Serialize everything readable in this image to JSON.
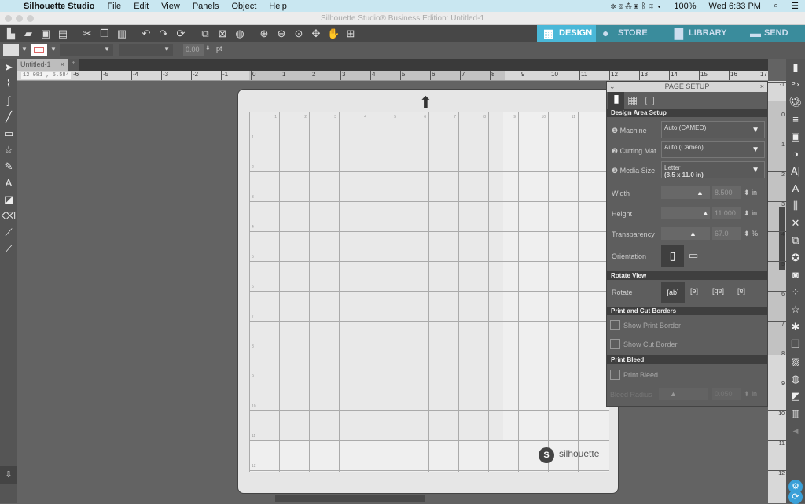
{
  "menubar": {
    "app": "Silhouette Studio",
    "items": [
      "File",
      "Edit",
      "View",
      "Panels",
      "Object",
      "Help"
    ],
    "battery": "100%",
    "clock": "Wed 6:33 PM"
  },
  "window": {
    "title": "Silhouette Studio® Business Edition: Untitled-1"
  },
  "nav_tabs": [
    {
      "label": "DESIGN",
      "icon": "grid-icon",
      "active": true
    },
    {
      "label": "STORE",
      "icon": "silhouette-s-icon"
    },
    {
      "label": "LIBRARY",
      "icon": "folder-download-icon"
    },
    {
      "label": "SEND",
      "icon": "cutter-icon"
    }
  ],
  "toolbar2": {
    "line_width": "0.00",
    "unit": "pt"
  },
  "document_tab": "Untitled-1",
  "ruler": {
    "coords": "12.081 , 5.584",
    "ticks": [
      "-6",
      "-5",
      "-4",
      "-3",
      "-2",
      "-1",
      "0",
      "1",
      "2",
      "3",
      "4",
      "5",
      "6",
      "7",
      "8",
      "9",
      "10",
      "11",
      "12",
      "13",
      "14",
      "15",
      "16",
      "17"
    ],
    "vticks": [
      "-1",
      "0",
      "1",
      "2",
      "3",
      "4",
      "5",
      "6",
      "7",
      "8",
      "9",
      "10",
      "11",
      "12"
    ]
  },
  "mat": {
    "brand": "silhouette",
    "col_labels": [
      "1",
      "2",
      "3",
      "4",
      "5",
      "6",
      "7",
      "8",
      "9",
      "10",
      "11"
    ],
    "row_labels": [
      "1",
      "2",
      "3",
      "4",
      "5",
      "6",
      "7",
      "8",
      "9",
      "10",
      "11",
      "12"
    ]
  },
  "page_setup": {
    "title": "PAGE SETUP",
    "design_area": "Design Area Setup",
    "machine_label": "Machine",
    "machine": "Auto (CAMEO)",
    "mat_label": "Cutting Mat",
    "mat": "Auto (Cameo)",
    "media_label": "Media Size",
    "media": "Letter",
    "media_dims": "(8.5 x 11.0 in)",
    "width_label": "Width",
    "width": "8.500",
    "width_unit": "in",
    "height_label": "Height",
    "height": "11.000",
    "height_unit": "in",
    "transparency_label": "Transparency",
    "transparency": "67.0",
    "transparency_unit": "%",
    "orientation_label": "Orientation",
    "rotate_view": "Rotate View",
    "rotate_label": "Rotate",
    "borders": "Print and Cut Borders",
    "show_print": "Show Print Border",
    "show_cut": "Show Cut Border",
    "bleed": "Print Bleed",
    "print_bleed": "Print Bleed",
    "bleed_radius_label": "Bleed Radius",
    "bleed_radius": "0.050",
    "bleed_unit": "in"
  },
  "colors": {
    "design_tab": "#4ab8d8",
    "other_tabs": "#3a8c9c",
    "canvas": "#636363",
    "mat": "#e6e6e6"
  }
}
